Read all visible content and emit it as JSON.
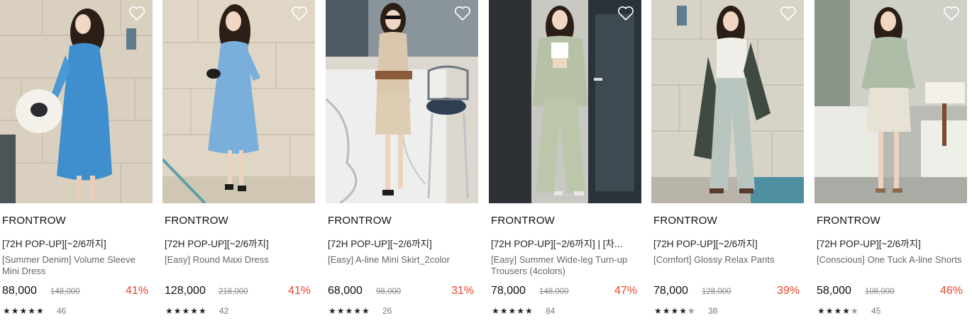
{
  "colors": {
    "discount": "#e8452c",
    "text": "#222222",
    "muted": "#888888"
  },
  "products": [
    {
      "brand": "FRONTROW",
      "promo": "[72H POP-UP][~2/6까지]",
      "name": "[Summer Denim] Volume Sleeve Mini Dress",
      "price": "88,000",
      "original_price": "148,000",
      "discount": "41%",
      "rating": 5,
      "reviews": "46"
    },
    {
      "brand": "FRONTROW",
      "promo": "[72H POP-UP][~2/6까지]",
      "name": "[Easy] Round Maxi Dress",
      "price": "128,000",
      "original_price": "218,000",
      "discount": "41%",
      "rating": 5,
      "reviews": "42"
    },
    {
      "brand": "FRONTROW",
      "promo": "[72H POP-UP][~2/6까지]",
      "name": "[Easy] A-line Mini Skirt_2color",
      "price": "68,000",
      "original_price": "98,000",
      "discount": "31%",
      "rating": 5,
      "reviews": "26"
    },
    {
      "brand": "FRONTROW",
      "promo": "[72H POP-UP][~2/6까지] | [차...",
      "name": "[Easy] Summer Wide-leg Turn-up Trousers (4colors)",
      "price": "78,000",
      "original_price": "148,000",
      "discount": "47%",
      "rating": 5,
      "reviews": "84"
    },
    {
      "brand": "FRONTROW",
      "promo": "[72H POP-UP][~2/6까지]",
      "name": "[Comfort] Glossy Relax Pants",
      "price": "78,000",
      "original_price": "128,000",
      "discount": "39%",
      "rating": 4.5,
      "reviews": "38"
    },
    {
      "brand": "FRONTROW",
      "promo": "[72H POP-UP][~2/6까지]",
      "name": "[Conscious] One Tuck A-line Shorts",
      "price": "58,000",
      "original_price": "108,000",
      "discount": "46%",
      "rating": 4.5,
      "reviews": "45"
    }
  ]
}
